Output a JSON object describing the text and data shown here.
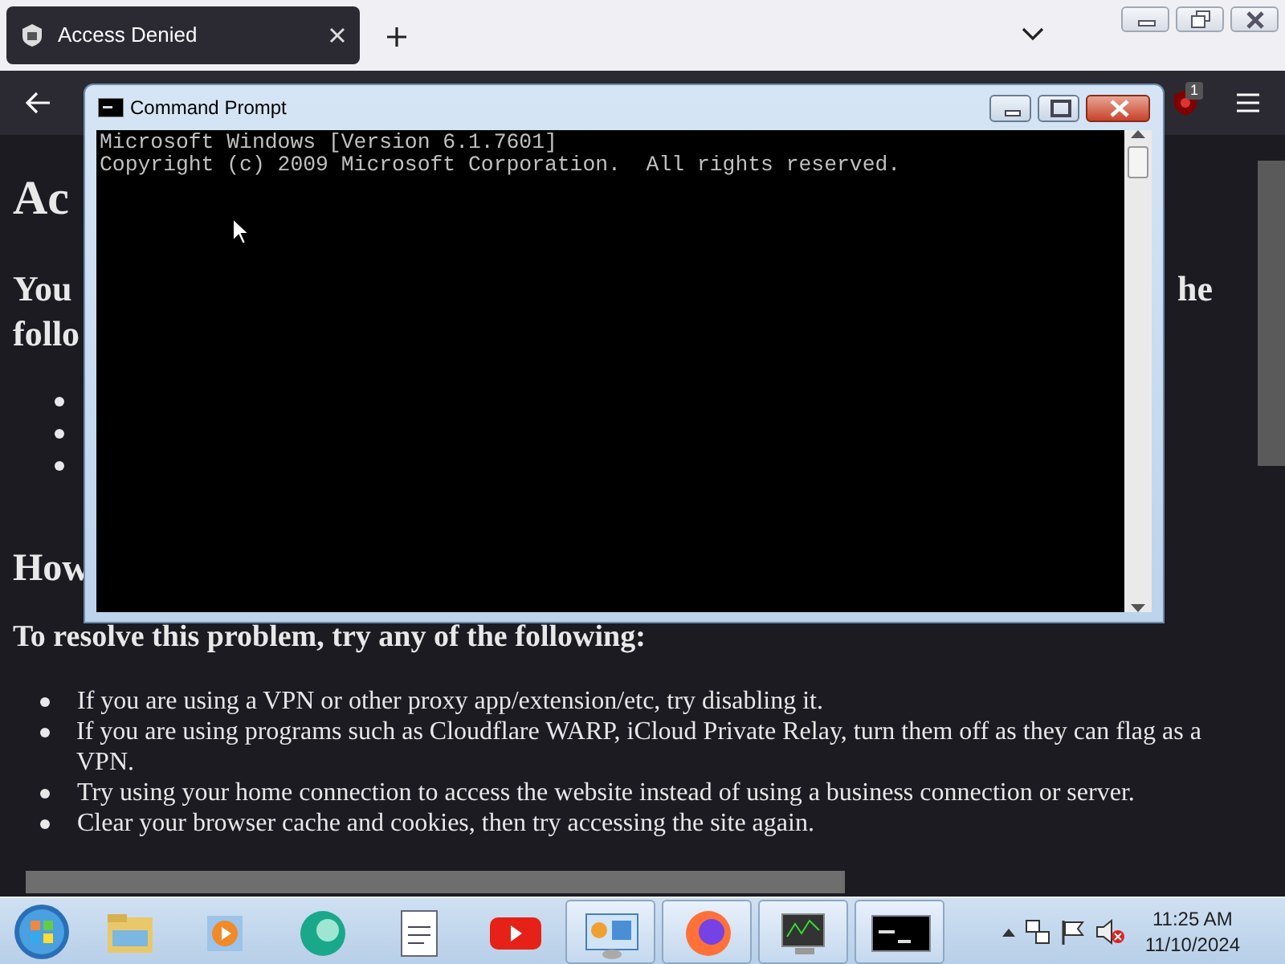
{
  "browser": {
    "tabs": [
      {
        "title": "Access Denied",
        "selected": true
      }
    ],
    "extension": {
      "badge": "1"
    }
  },
  "page": {
    "left_fragments": [
      {
        "kind": "heading",
        "text": "Ac"
      },
      {
        "kind": "subheading",
        "text": "You"
      },
      {
        "kind": "subheading",
        "text": "follo"
      },
      {
        "kind": "bullet"
      },
      {
        "kind": "bullet"
      },
      {
        "kind": "bullet"
      },
      {
        "kind": "heading",
        "text": "How"
      }
    ],
    "right_fragments": [
      {
        "kind": "subheading",
        "text": "he"
      }
    ],
    "instructions_title": "To resolve this problem, try any of the following:",
    "instructions": [
      "If you are using a VPN or other proxy app/extension/etc, try disabling it.",
      "If you are using programs such as Cloudflare WARP, iCloud Private Relay, turn them off as they can flag as a VPN.",
      "Try using your home connection to access the website instead of using a business connection or server.",
      "Clear your browser cache and cookies, then try accessing the site again."
    ]
  },
  "command_prompt": {
    "title": "Command Prompt",
    "lines": [
      "Microsoft Windows [Version 6.1.7601]",
      "Copyright (c) 2009 Microsoft Corporation.  All rights reserved."
    ]
  },
  "taskbar": {
    "items": [
      {
        "kind": "explorer",
        "running": false
      },
      {
        "kind": "media",
        "running": false
      },
      {
        "kind": "orb",
        "running": false
      },
      {
        "kind": "notepad",
        "running": false
      },
      {
        "kind": "video",
        "running": false
      },
      {
        "kind": "remote",
        "running": true
      },
      {
        "kind": "firefox",
        "running": true
      },
      {
        "kind": "monitor",
        "running": true
      },
      {
        "kind": "console",
        "running": true
      }
    ],
    "tray": {
      "muted": true
    },
    "clock": {
      "time": "11:25 AM",
      "date": "11/10/2024"
    }
  }
}
